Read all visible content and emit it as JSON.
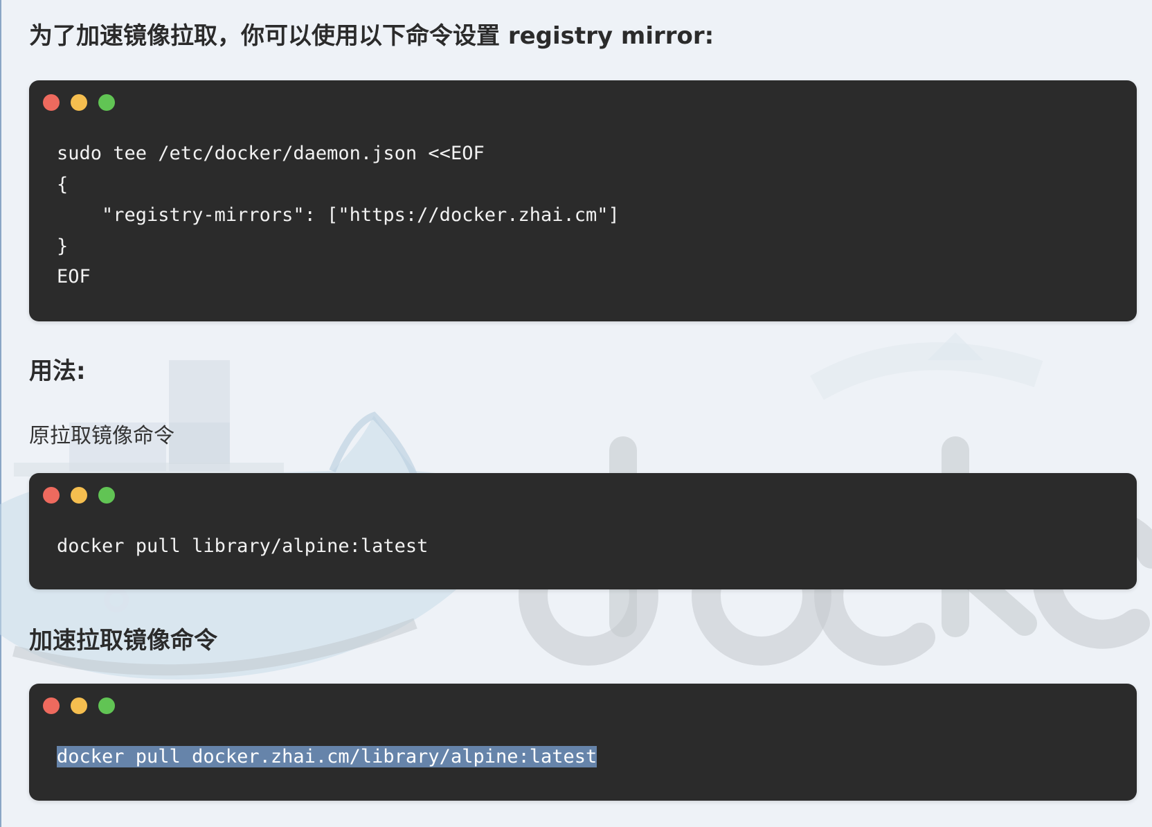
{
  "heading_main": "为了加速镜像拉取，你可以使用以下命令设置 registry mirror:",
  "code_block_1": {
    "lines": [
      "sudo tee /etc/docker/daemon.json <<EOF",
      "{",
      "    \"registry-mirrors\": [\"https://docker.zhai.cm\"]",
      "}",
      "EOF"
    ]
  },
  "usage_heading": "用法:",
  "original_label": "原拉取镜像命令",
  "code_block_2": {
    "lines": [
      "docker pull library/alpine:latest"
    ]
  },
  "accel_heading": "加速拉取镜像命令",
  "code_block_3": {
    "lines": [
      "docker pull docker.zhai.cm/library/alpine:latest"
    ],
    "selected": true
  },
  "colors": {
    "code_bg": "#2b2b2b",
    "dot_red": "#ee6a5e",
    "dot_yellow": "#f5be4f",
    "dot_green": "#61c454",
    "selection": "#6684aa",
    "page_bg": "#eef2f7"
  },
  "watermark": "docker"
}
